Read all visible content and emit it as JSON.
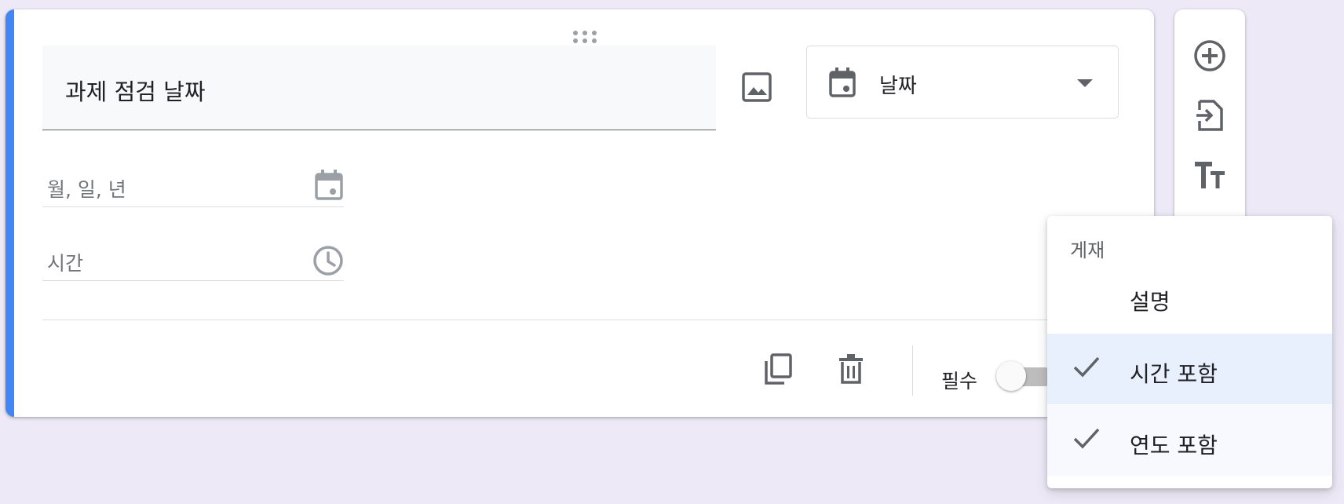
{
  "question": {
    "title": "과제 점검 날짜",
    "type_label": "날짜",
    "date_placeholder": "월, 일, 년",
    "time_placeholder": "시간",
    "required_label": "필수",
    "required_on": false
  },
  "menu": {
    "header": "게재",
    "items": [
      {
        "label": "설명",
        "checked": false
      },
      {
        "label": "시간 포함",
        "checked": true
      },
      {
        "label": "연도 포함",
        "checked": true
      }
    ]
  },
  "colors": {
    "accent": "#4285f4",
    "background": "#ede9f7",
    "highlight": "#e8f0fe"
  },
  "icons": {
    "drag": "drag-handle-icon",
    "image": "image-icon",
    "type": "calendar-icon",
    "date": "calendar-icon",
    "time": "clock-icon",
    "copy": "copy-icon",
    "delete": "trash-icon",
    "toolbar": [
      "add-circle-icon",
      "import-icon",
      "title-text-icon"
    ]
  }
}
